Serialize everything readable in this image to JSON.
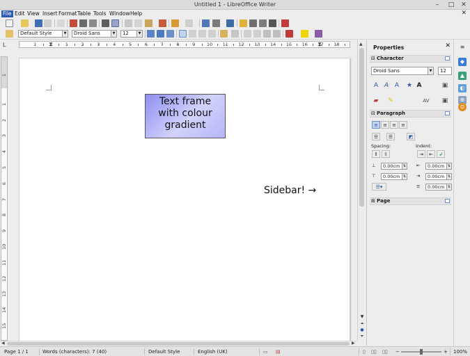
{
  "window": {
    "title": "Untitled 1 - LibreOffice Writer",
    "controls": [
      "–",
      "□",
      "✕"
    ]
  },
  "menu": {
    "items": [
      "File",
      "Edit",
      "View",
      "Insert",
      "Format",
      "Table",
      "Tools",
      "Window",
      "Help"
    ],
    "active": "File",
    "close_doc": "✕"
  },
  "formatting": {
    "paragraph_style": "Default Style",
    "font_name": "Droid Sans",
    "font_size": "12"
  },
  "ruler": {
    "tab_type": "L",
    "numbers": [
      "1",
      "1",
      "2",
      "3",
      "4",
      "5",
      "6",
      "7",
      "8",
      "9",
      "10",
      "11",
      "12",
      "13",
      "14",
      "15",
      "16",
      "17",
      "18"
    ]
  },
  "vertical_ruler": {
    "numbers": [
      "1",
      "1",
      "2",
      "3",
      "4",
      "5",
      "6",
      "7",
      "8",
      "9",
      "10",
      "11",
      "12",
      "13",
      "14",
      "15"
    ]
  },
  "document": {
    "text_frame_lines": [
      "Text frame",
      "with colour",
      "gradient"
    ],
    "note": "Sidebar! →"
  },
  "sidebar": {
    "title": "Properties",
    "close": "✕",
    "character": {
      "heading": "Character",
      "font_name": "Droid Sans",
      "font_size": "12"
    },
    "paragraph": {
      "heading": "Paragraph",
      "spacing_label": "Spacing:",
      "indent_label": "Indent:",
      "above": "0.00cm",
      "below": "0.00cm",
      "before_text": "0.00cm",
      "after_text": "0.00cm",
      "first_line": "0.00cm"
    },
    "page": {
      "heading": "Page"
    },
    "toggles": {
      "expanded": "⊟",
      "collapsed": "⊞"
    }
  },
  "statusbar": {
    "page": "Page 1 / 1",
    "words": "Words (characters): 7 (40)",
    "style": "Default Style",
    "language": "English (UK)",
    "zoom_minus": "−",
    "zoom_plus": "+",
    "zoom": "100%",
    "zoom_level": 1.0
  },
  "colors": {
    "menu_active": "#2a5bb3",
    "frame_gradient_start": "#8e8ef2",
    "frame_gradient_end": "#d2d2fb",
    "icon_blue": "#2a55a8"
  }
}
